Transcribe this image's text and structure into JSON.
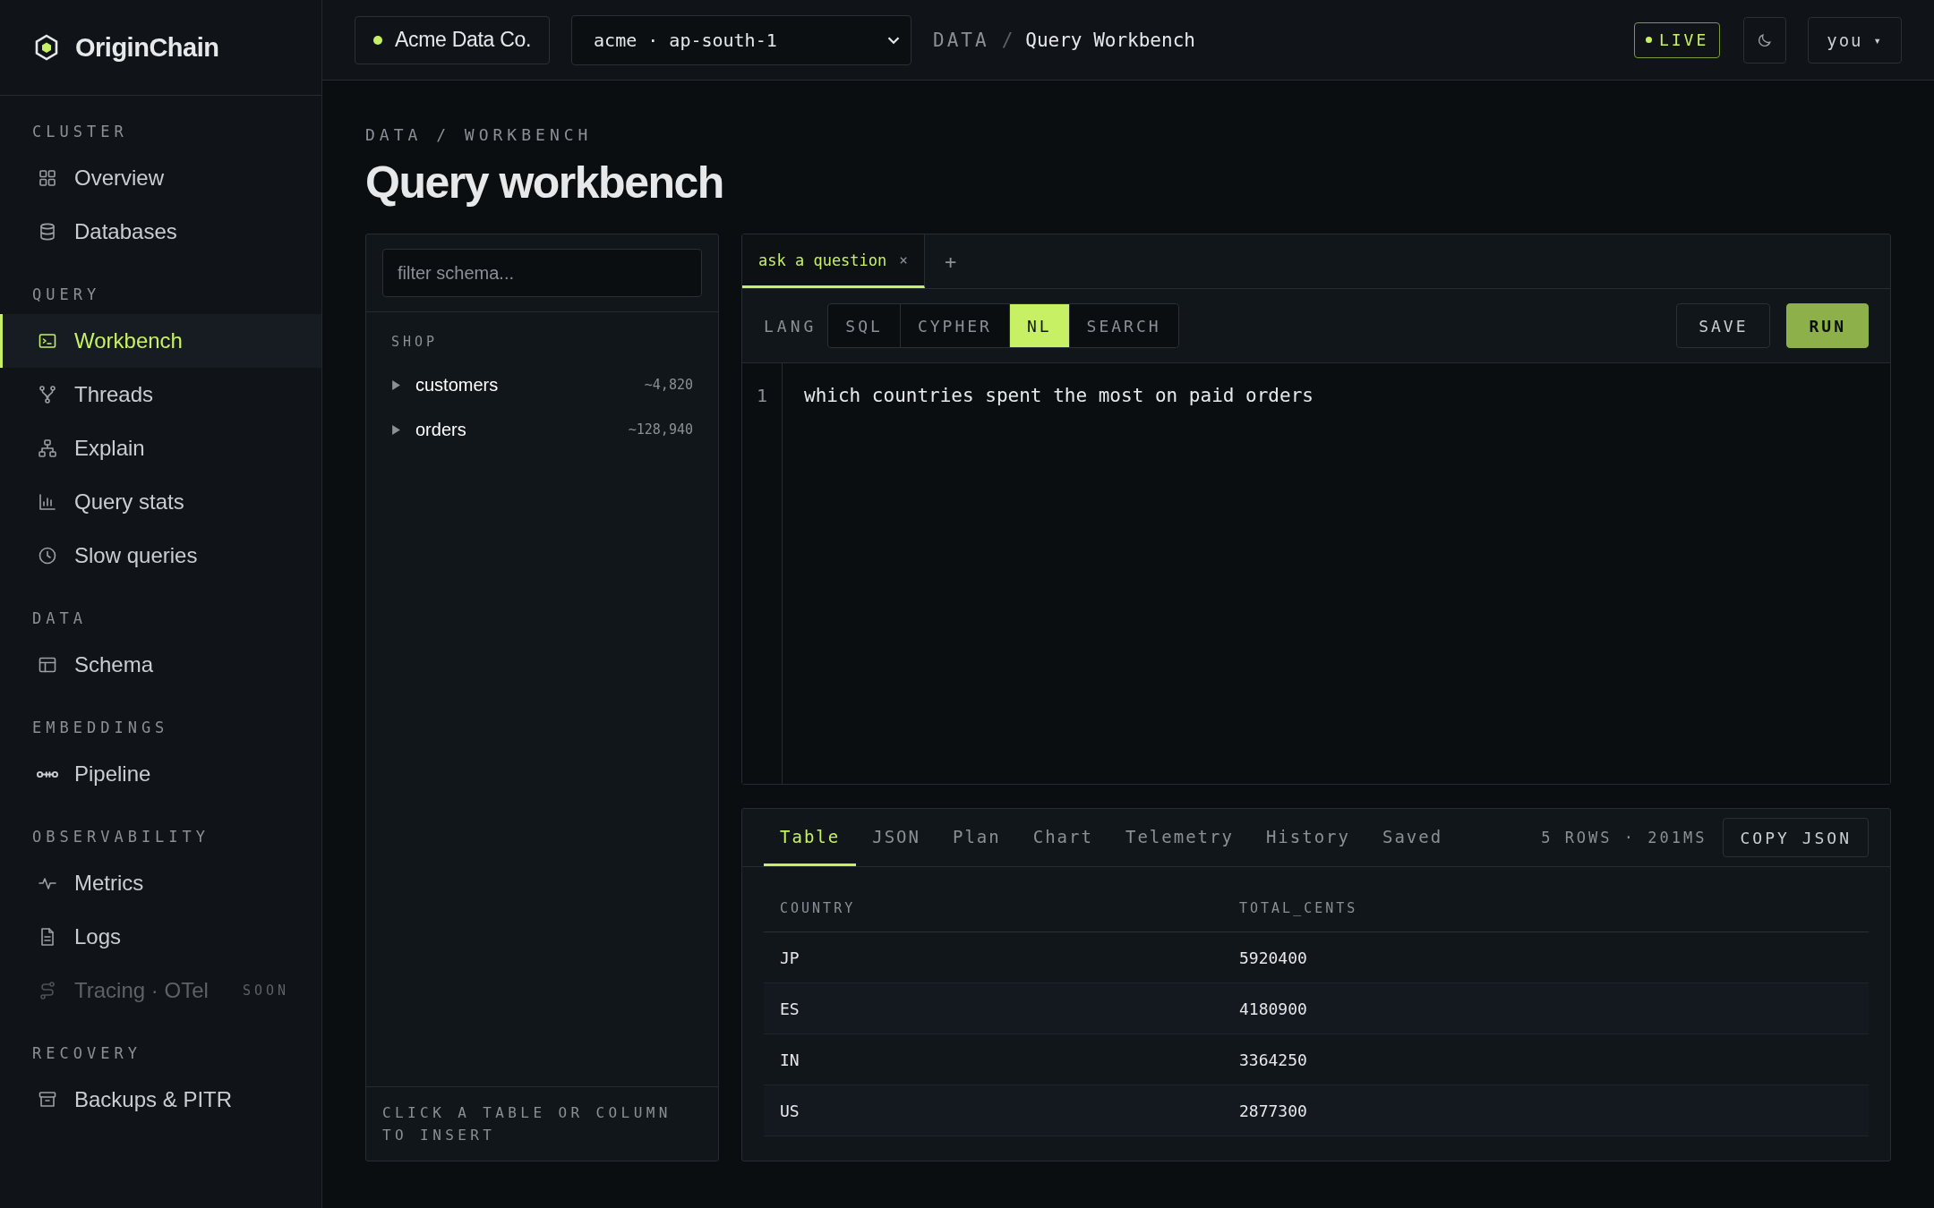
{
  "sidebar": {
    "brand": "OriginChain",
    "sections": [
      {
        "label": "CLUSTER",
        "items": [
          {
            "label": "Overview",
            "selected": false,
            "disabled": false
          },
          {
            "label": "Databases",
            "selected": false,
            "disabled": false
          }
        ]
      },
      {
        "label": "QUERY",
        "items": [
          {
            "label": "Workbench",
            "selected": true,
            "disabled": false
          },
          {
            "label": "Threads",
            "selected": false,
            "disabled": false
          },
          {
            "label": "Explain",
            "selected": false,
            "disabled": false
          },
          {
            "label": "Query stats",
            "selected": false,
            "disabled": false
          },
          {
            "label": "Slow queries",
            "selected": false,
            "disabled": false
          }
        ]
      },
      {
        "label": "DATA",
        "items": [
          {
            "label": "Schema",
            "selected": false,
            "disabled": false
          }
        ]
      },
      {
        "label": "EMBEDDINGS",
        "items": [
          {
            "label": "Pipeline",
            "selected": false,
            "disabled": false
          }
        ]
      },
      {
        "label": "OBSERVABILITY",
        "items": [
          {
            "label": "Metrics",
            "selected": false,
            "disabled": false
          },
          {
            "label": "Logs",
            "selected": false,
            "disabled": false
          },
          {
            "label": "Tracing · OTel",
            "selected": false,
            "disabled": true,
            "badge": "SOON"
          }
        ]
      },
      {
        "label": "RECOVERY",
        "items": [
          {
            "label": "Backups & PITR",
            "selected": false,
            "disabled": false
          }
        ]
      }
    ]
  },
  "topbar": {
    "org": "Acme Data Co.",
    "region": "acme · ap-south-1",
    "breadcrumb": {
      "root": "DATA",
      "separator": "/",
      "current": "Query Workbench"
    },
    "live": "LIVE",
    "user": "you",
    "user_caret": "▾"
  },
  "page": {
    "breadcrumb": "DATA / WORKBENCH",
    "title": "Query workbench"
  },
  "schema": {
    "placeholder": "filter schema...",
    "group": "SHOP",
    "tables": [
      {
        "name": "customers",
        "count": "~4,820",
        "expanded": false
      },
      {
        "name": "orders",
        "count": "~128,940",
        "expanded": false
      }
    ],
    "hint": "CLICK A TABLE OR COLUMN TO INSERT"
  },
  "editor": {
    "tabs": [
      {
        "label": "ask a question",
        "close": "×",
        "selected": true
      }
    ],
    "add": "+",
    "lang_label": "LANG",
    "langs": [
      {
        "label": "SQL",
        "selected": false
      },
      {
        "label": "CYPHER",
        "selected": false
      },
      {
        "label": "NL",
        "selected": true
      },
      {
        "label": "SEARCH",
        "selected": false
      }
    ],
    "save": "SAVE",
    "run": "RUN",
    "lines": [
      {
        "number": "1",
        "text": "which countries spent the most on paid orders"
      }
    ]
  },
  "results": {
    "tabs": [
      {
        "label": "Table",
        "selected": true
      },
      {
        "label": "JSON",
        "selected": false
      },
      {
        "label": "Plan",
        "selected": false
      },
      {
        "label": "Chart",
        "selected": false
      },
      {
        "label": "Telemetry",
        "selected": false
      },
      {
        "label": "History",
        "selected": false
      },
      {
        "label": "Saved",
        "selected": false
      }
    ],
    "summary": "5 ROWS · 201MS",
    "copy": "COPY JSON",
    "columns": [
      "COUNTRY",
      "TOTAL_CENTS"
    ],
    "rows": [
      [
        "JP",
        "5920400"
      ],
      [
        "ES",
        "4180900"
      ],
      [
        "IN",
        "3364250"
      ],
      [
        "US",
        "2877300"
      ]
    ]
  }
}
